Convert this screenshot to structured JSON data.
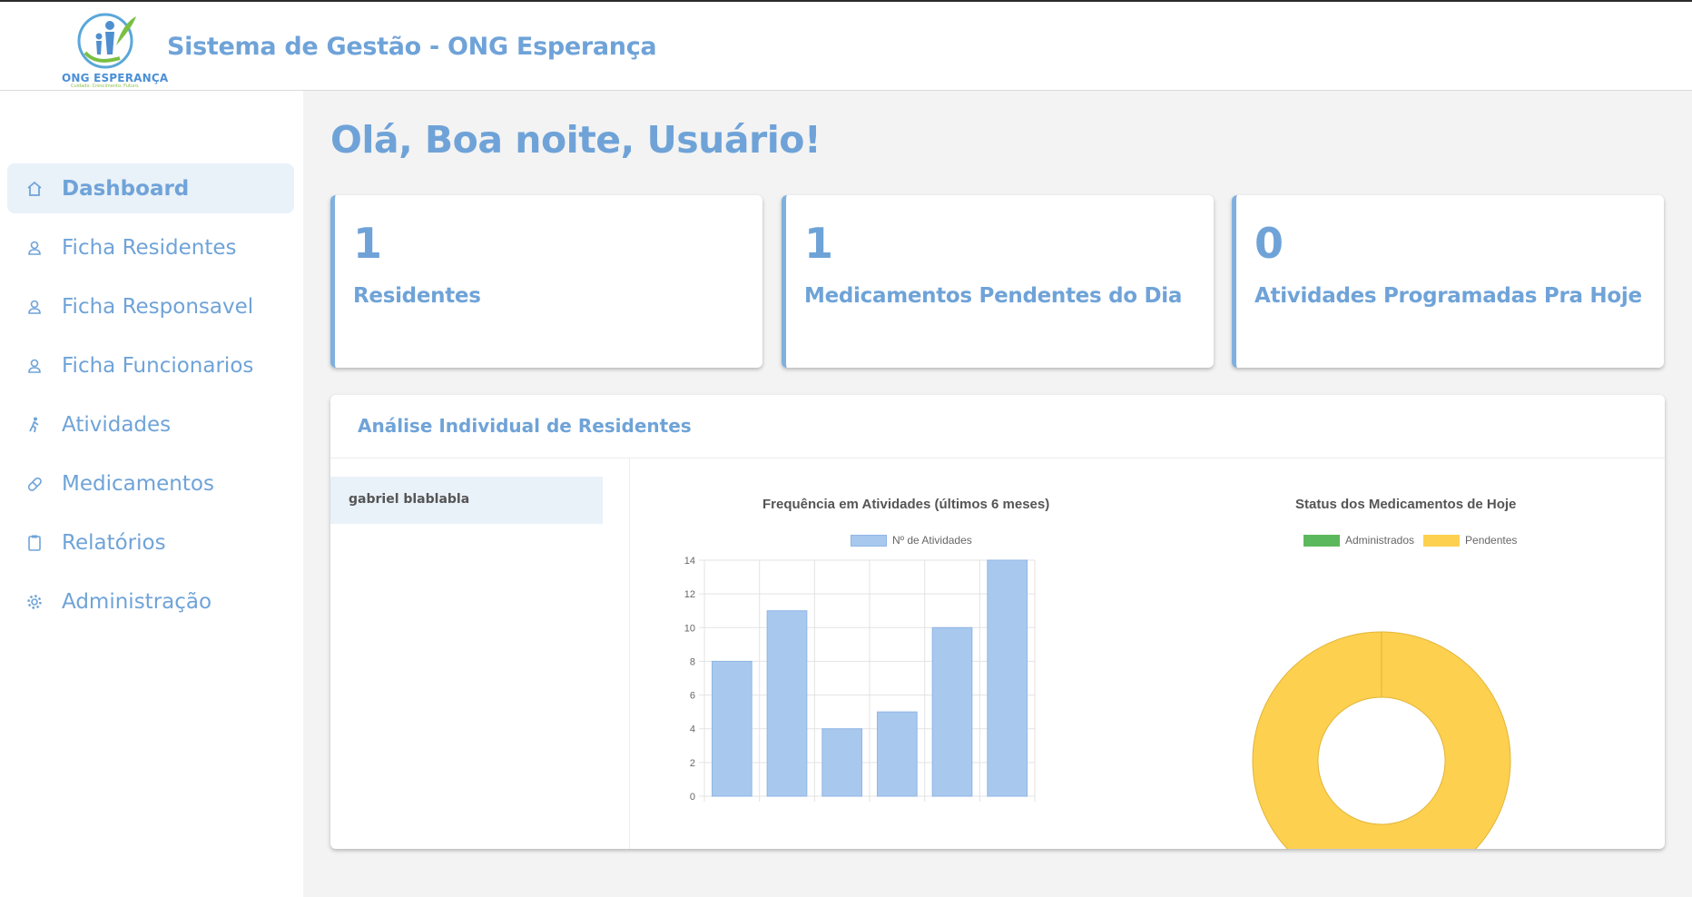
{
  "header": {
    "logo_text": "ONG ESPERANÇA",
    "logo_tagline": "Cuidado. Crescimento. Futuro.",
    "title": "Sistema de Gestão - ONG Esperança"
  },
  "sidebar": {
    "items": [
      {
        "label": "Dashboard",
        "icon": "home-icon",
        "active": true
      },
      {
        "label": "Ficha Residentes",
        "icon": "user-icon"
      },
      {
        "label": "Ficha Responsavel",
        "icon": "user-icon"
      },
      {
        "label": "Ficha Funcionarios",
        "icon": "user-icon"
      },
      {
        "label": "Atividades",
        "icon": "walking-icon"
      },
      {
        "label": "Medicamentos",
        "icon": "pill-icon"
      },
      {
        "label": "Relatórios",
        "icon": "clipboard-icon"
      },
      {
        "label": "Administração",
        "icon": "gear-icon"
      }
    ]
  },
  "main": {
    "greeting": "Olá, Boa noite, Usuário!",
    "stats": [
      {
        "value": "1",
        "label": "Residentes"
      },
      {
        "value": "1",
        "label": "Medicamentos Pendentes do Dia"
      },
      {
        "value": "0",
        "label": "Atividades Programadas Pra Hoje"
      }
    ],
    "analysis": {
      "title": "Análise Individual de Residentes",
      "residents": [
        "gabriel blablabla"
      ]
    }
  },
  "colors": {
    "accent": "#6fa3d8",
    "bar": "#a8c8ee",
    "bar_border": "#8fb6e6",
    "administered": "#5cb85c",
    "pending": "#fdd04f"
  },
  "chart_data": [
    {
      "type": "bar",
      "title": "Frequência em Atividades (últimos 6 meses)",
      "categories": [
        "",
        "",
        "",
        "",
        "",
        ""
      ],
      "series": [
        {
          "name": "Nº de Atividades",
          "values": [
            8,
            11,
            4,
            5,
            10,
            14
          ]
        }
      ],
      "ylim": [
        0,
        14
      ],
      "yticks": [
        0,
        2,
        4,
        6,
        8,
        10,
        12,
        14
      ],
      "grid": true,
      "legend": "top"
    },
    {
      "type": "pie",
      "title": "Status dos Medicamentos de Hoje",
      "labels": [
        "Administrados",
        "Pendentes"
      ],
      "values": [
        0,
        1
      ],
      "legend": "top"
    }
  ]
}
